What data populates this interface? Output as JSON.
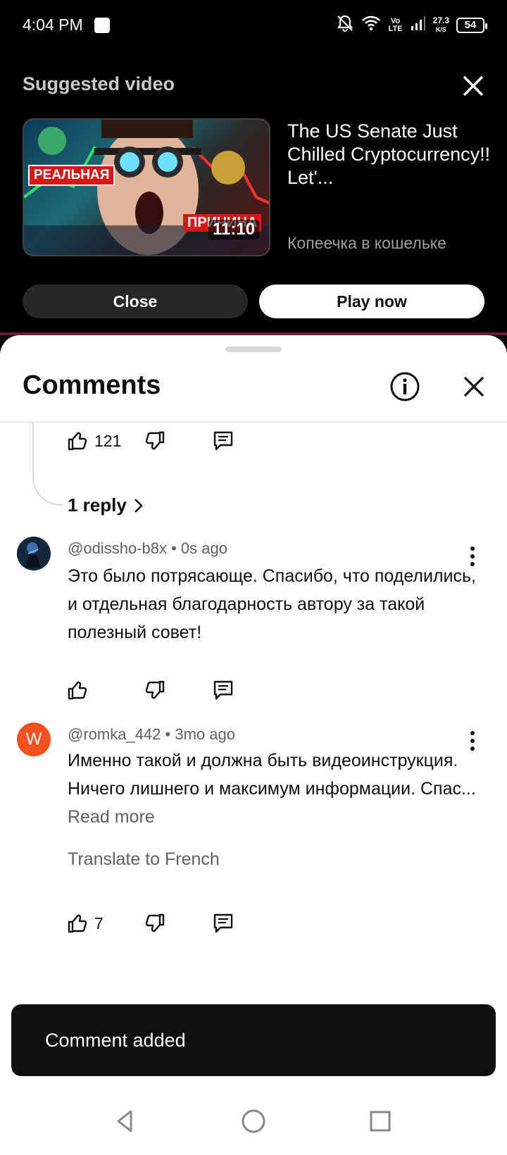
{
  "status_bar": {
    "time": "4:04 PM",
    "network_label": "Vo LTE",
    "speed_value": "27.3",
    "speed_unit": "K/S",
    "battery": "54"
  },
  "suggested": {
    "heading": "Suggested video",
    "thumbnail": {
      "tag_left": "РЕАЛЬНАЯ",
      "tag_right": "ПРИЧИНА",
      "duration": "11:10",
      "colors": {
        "tag": "#d11b1b"
      }
    },
    "video_title": "The US Senate Just Chilled Cryptocurrency!! Let'...",
    "channel": "Копеечка в кошельке",
    "close_label": "Close",
    "play_label": "Play now"
  },
  "comments": {
    "title": "Comments",
    "top_actions": {
      "like_count": "121"
    },
    "reply_link": "1 reply",
    "items": [
      {
        "author": "@odissho-b8x",
        "time": "0s ago",
        "separator": " • ",
        "text": "Это было потрясающе. Спасибо, что поделились, и отдельная благодарность автору за такой полезный совет!",
        "like_count": ""
      },
      {
        "author": "@romka_442",
        "time": "3mo ago",
        "separator": " • ",
        "avatar_letter": "W",
        "text": "Именно такой и должна быть видеоинструкция. Ничего лишнего и максимум информации. Спас...",
        "read_more": "Read more",
        "translate": "Translate to French",
        "like_count": "7"
      }
    ]
  },
  "snackbar": {
    "text": "Comment added"
  },
  "colors": {
    "accent_line": "#6b1e35",
    "avatar_w": "#f4511e"
  }
}
